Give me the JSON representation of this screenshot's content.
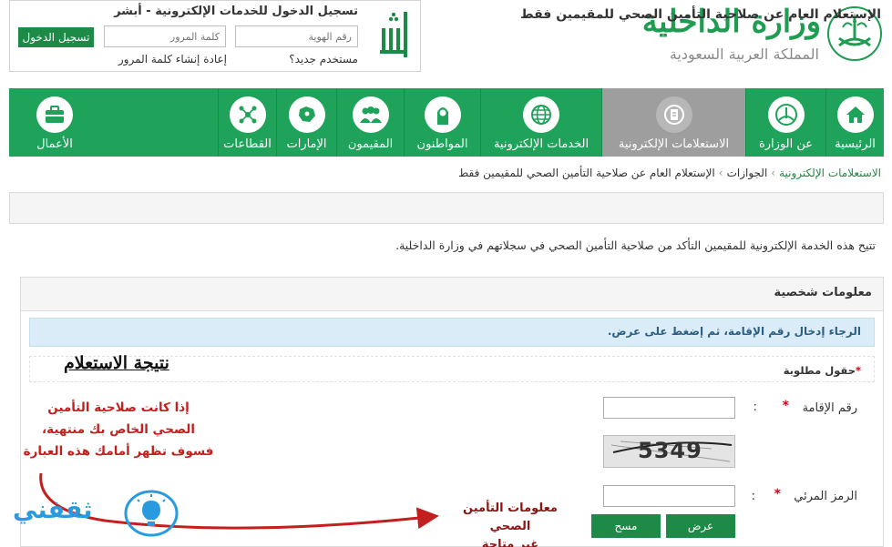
{
  "header": {
    "ministry_title": "وزارة الداخلية",
    "ministry_subtitle": "المملكة العربية السعودية",
    "login": {
      "title": "تسجيل الدخول للخدمات الإلكترونية - أبشر",
      "id_placeholder": "رقم الهوية",
      "password_placeholder": "كلمة المرور",
      "login_button": "تسجيل الدخول",
      "new_user_link": "مستخدم جديد؟",
      "reset_password_link": "إعادة إنشاء كلمة المرور"
    }
  },
  "nav": {
    "items": [
      {
        "label": "الرئيسية",
        "icon": "home-icon"
      },
      {
        "label": "عن الوزارة",
        "icon": "emblem-icon"
      },
      {
        "label": "الاستعلامات الإلكترونية",
        "icon": "inquiry-icon",
        "active": true
      },
      {
        "label": "الخدمات الإلكترونية",
        "icon": "globe-icon"
      },
      {
        "label": "المواطنون",
        "icon": "citizen-icon"
      },
      {
        "label": "المقيمون",
        "icon": "residents-icon"
      },
      {
        "label": "الإمارات",
        "icon": "regions-icon"
      },
      {
        "label": "القطاعات",
        "icon": "sectors-icon"
      },
      {
        "label": "الأعمال",
        "icon": "briefcase-icon"
      }
    ],
    "colors": {
      "bar": "#1fa25a",
      "active": "#9e9e9e"
    }
  },
  "breadcrumb": {
    "items": [
      "الاستعلامات الإلكترونية",
      "الجوازات",
      "الإستعلام العام عن صلاحية التأمين الصحي للمقيمين فقط"
    ]
  },
  "main": {
    "page_title": "الإستعلام العام عن صلاحية التأمين الصحي للمقيمين فقط",
    "intro": "تتيح هذه الخدمة الإلكترونية للمقيمين التأكد من صلاحية التأمين الصحي في سجلاتهم في وزارة الداخلية.",
    "section_title": "معلومات شخصية",
    "info_message": "الرجاء إدخال رقم الإقامة، ثم إضغط على عرض.",
    "required_note": "حقول مطلوبة",
    "required_star": "*",
    "fields": {
      "iqama_label": "رقم الإقامة",
      "code_label": "الرمز المرئي",
      "colon": ":",
      "star": "*"
    },
    "captcha_text": "5349",
    "buttons": {
      "show": "عرض",
      "clear": "مسح"
    }
  },
  "annotations": {
    "result_heading": "نتيجة الاستعلام",
    "red_note_lines": [
      "إذا كانت صلاحية التأمين",
      "الصحي الخاص بك منتهية،",
      "فسوف تظهر أمامك هذه العبارة"
    ],
    "bottom_note_lines": [
      "معلومات التأمين الصحي",
      "غير متاحة"
    ],
    "watermark": "ثقفني"
  },
  "colors": {
    "brand_green": "#1e8a48",
    "accent_red": "#c41f1f",
    "info_bg": "#d9ecf7"
  }
}
